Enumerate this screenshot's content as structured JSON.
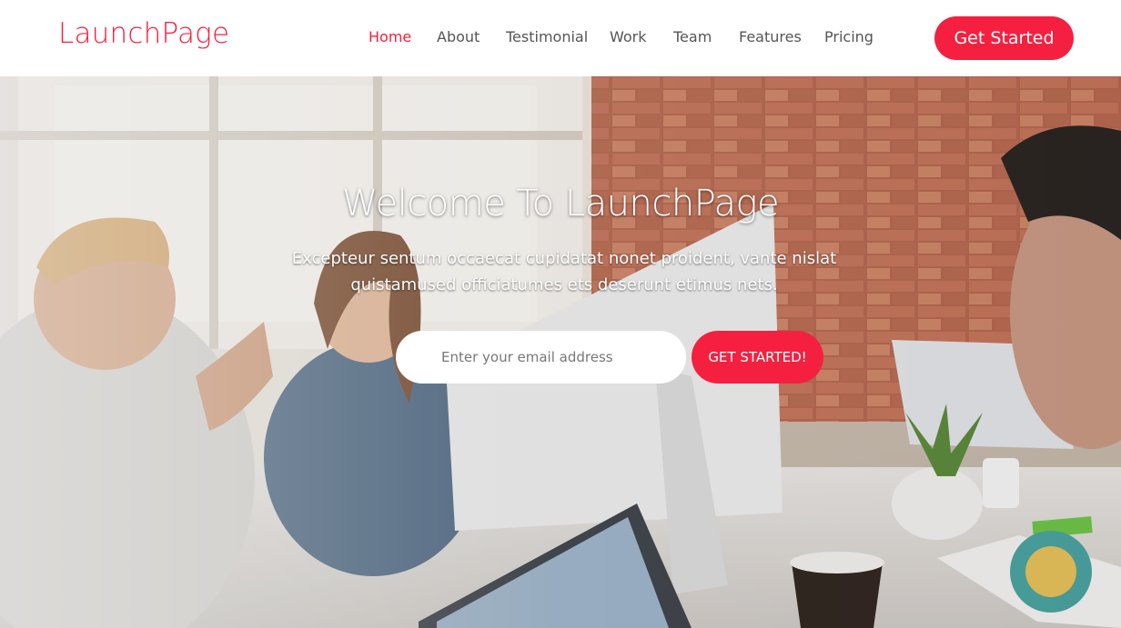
{
  "brand": {
    "logo_text": "LaunchPage",
    "accent_color": "#f5203f"
  },
  "nav": {
    "items": [
      {
        "label": "Home",
        "active": true
      },
      {
        "label": "About",
        "active": false
      },
      {
        "label": "Testimonial",
        "active": false
      },
      {
        "label": "Work",
        "active": false
      },
      {
        "label": "Team",
        "active": false
      },
      {
        "label": "Features",
        "active": false
      },
      {
        "label": "Pricing",
        "active": false
      }
    ],
    "cta_label": "Get Started"
  },
  "hero": {
    "title": "Welcome To LaunchPage",
    "subtitle": "Excepteur sentum occaecat cupidatat nonet proident, vante nislat quistamused officiatumes ets deserunt etimus nets.",
    "email_placeholder": "Enter your email address",
    "email_value": "",
    "submit_label": "GET STARTED!",
    "background_image": "office-team-photo"
  }
}
